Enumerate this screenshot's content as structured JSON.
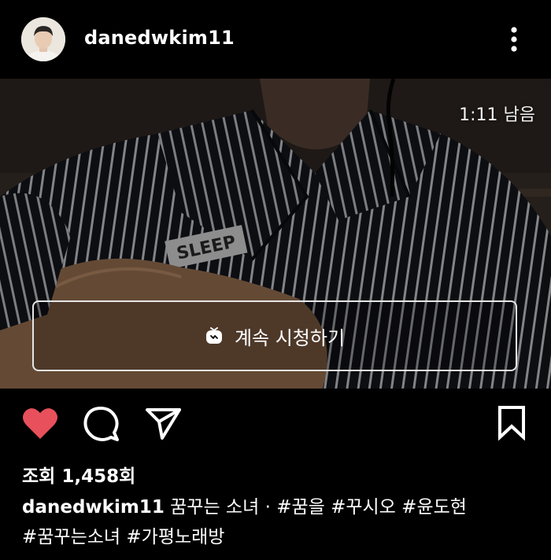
{
  "post": {
    "username": "danedwkim11",
    "video": {
      "time_remaining": "1:11 남음",
      "continue_label": "계속 시청하기",
      "shirt_patch": "SLEEP"
    },
    "views_label": "조회 1,458회",
    "caption": {
      "username": "danedwkim11",
      "text": "꿈꾸는 소녀 · ",
      "hashtags": [
        "#꿈을",
        "#꾸시오",
        "#윤도현",
        "#꿈꾸는소녀",
        "#가평노래방"
      ]
    }
  },
  "icons": {
    "more": "more-vertical-icon",
    "like": "heart-icon",
    "comment": "comment-icon",
    "share": "paper-plane-icon",
    "save": "bookmark-icon",
    "igtv": "igtv-icon"
  },
  "colors": {
    "background": "#000000",
    "like_red": "#e8505b",
    "text": "#ffffff",
    "button_border": "#e6e6e6"
  }
}
